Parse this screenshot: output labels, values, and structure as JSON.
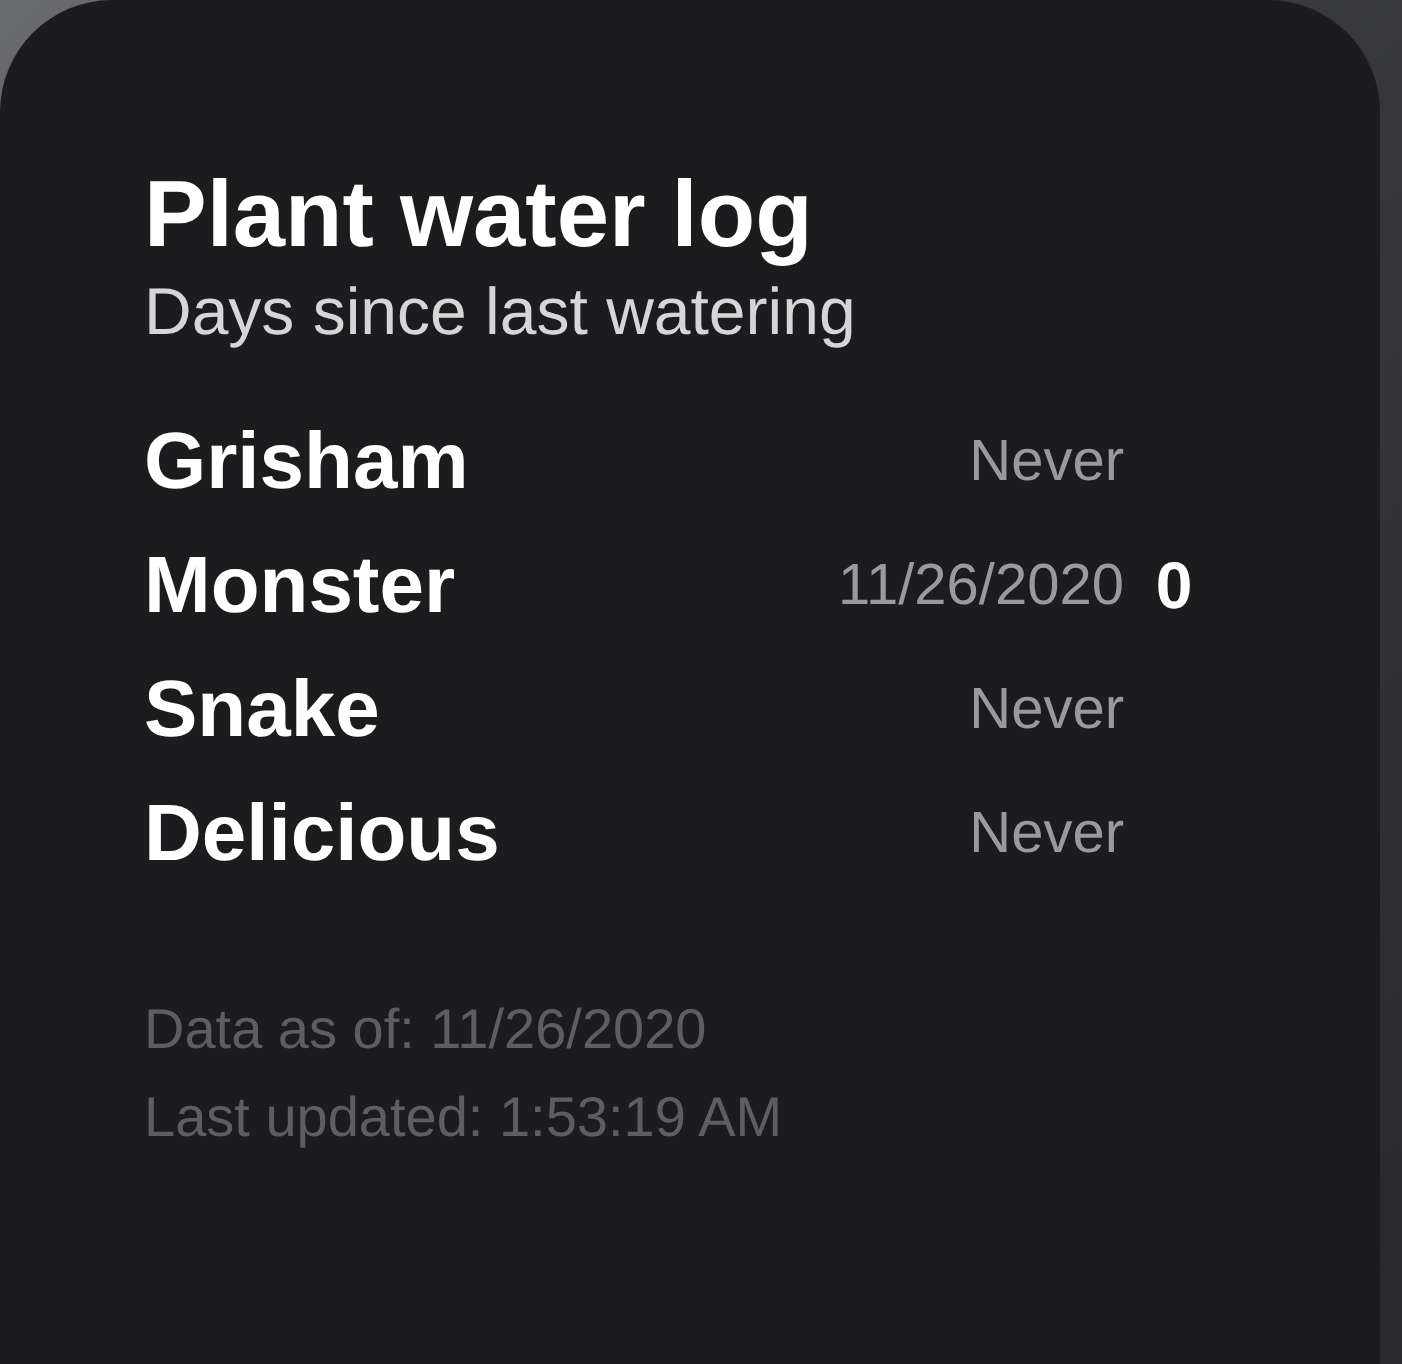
{
  "widget": {
    "title": "Plant water log",
    "subtitle": "Days since last watering",
    "plants": [
      {
        "name": "Grisham",
        "last_watered": "Never"
      },
      {
        "name": "Monster",
        "last_watered": "11/26/2020",
        "days": "0"
      },
      {
        "name": "Snake",
        "last_watered": "Never"
      },
      {
        "name": "Delicious",
        "last_watered": "Never"
      }
    ],
    "footer": [
      "Data as of: 11/26/2020",
      "Last updated: 1:53:19 AM"
    ]
  }
}
